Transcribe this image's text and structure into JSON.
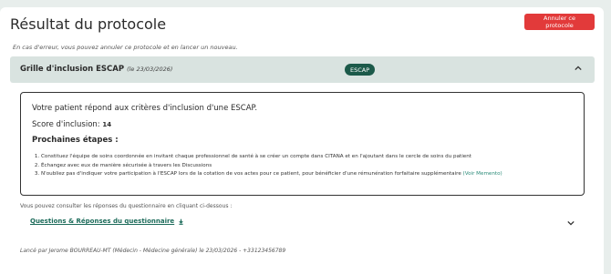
{
  "header": {
    "title": "Résultat du protocole",
    "cancel_label": "Annuler ce protocole"
  },
  "hint": "En cas d'erreur, vous pouvez annuler ce protocole et en lancer un nouveau.",
  "panel": {
    "title": "Grille d'inclusion ESCAP",
    "date": "(le 23/03/2026)",
    "badge": "ESCAP"
  },
  "result": {
    "line": "Votre patient répond aux critères d'inclusion d'une ESCAP.",
    "score_label": "Score d'inclusion:",
    "score_value": "14",
    "steps_heading": "Prochaines étapes :",
    "steps": [
      "Constituez l'équipe de soins coordonnée en invitant chaque professionnel de santé à se créer un compte dans CITANA et en l'ajoutant dans le cercle de soins du patient",
      "Échangez avec eux de manière sécurisée à travers les Discussions",
      "N'oubliez pas d'indiquer votre participation à l'ESCAP lors de la cotation de vos actes pour ce patient, pour bénéficier d'une rémunération forfaitaire supplémentaire"
    ],
    "memento_link": "(Voir Memento)"
  },
  "questionnaire": {
    "consult_text": "Vous pouvez consulter les réponses du questionnaire en cliquant ci-dessous :",
    "link_label": "Questions & Réponses du questionnaire"
  },
  "footer": "Lancé par Jerome BOURREAU-MT (Médecin - Médecine générale) le 23/03/2026 - +33123456789",
  "colors": {
    "accent": "#1c5a4a",
    "danger": "#e23a3a",
    "panel_bg": "#d9e3e0"
  }
}
